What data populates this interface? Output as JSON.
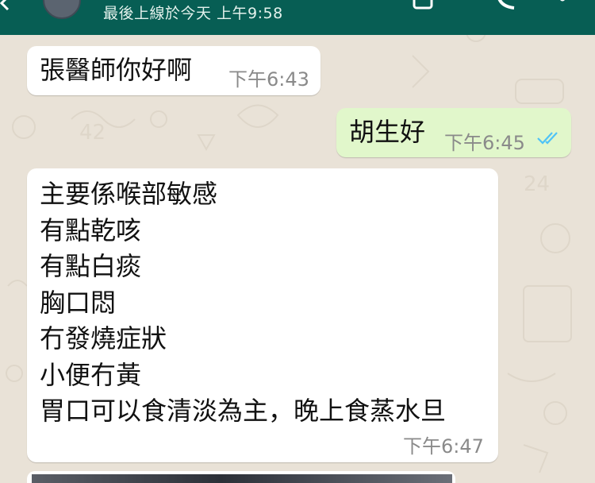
{
  "header": {
    "last_seen": "最後上線於今天 上午9:58"
  },
  "messages": [
    {
      "direction": "incoming",
      "text": "張醫師你好啊",
      "time": "下午6:43"
    },
    {
      "direction": "outgoing",
      "text": "胡生好",
      "time": "下午6:45",
      "status": "read"
    },
    {
      "direction": "incoming",
      "lines": [
        "主要係喉部敏感",
        "有點乾咳",
        "有點白痰",
        "胸口悶",
        "冇發燒症狀",
        "小便冇黃",
        "胃口可以食清淡為主，晚上食蒸水旦"
      ],
      "time": "下午6:47"
    }
  ],
  "colors": {
    "header": "#075e54",
    "chat_background": "#e9e2d7",
    "outgoing_bubble": "#e1f7cb",
    "incoming_bubble": "#ffffff",
    "read_ticks": "#4fc3f7"
  },
  "icons": [
    "back-arrow-icon",
    "video-call-icon",
    "voice-call-icon",
    "more-options-icon",
    "read-receipt-icon"
  ]
}
